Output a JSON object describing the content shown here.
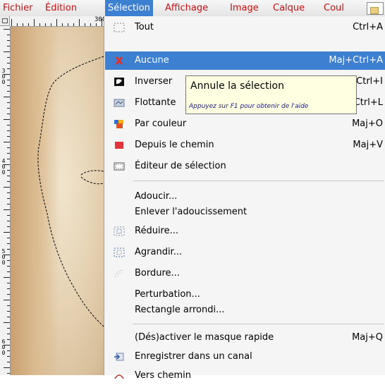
{
  "menubar": {
    "items": [
      "Fichier",
      "Édition",
      "Sélection",
      "Affichage",
      "Image",
      "Calque",
      "Coul"
    ],
    "active_index": 2
  },
  "ruler": {
    "h_label": "300",
    "v_labels": [
      "300",
      "400",
      "500",
      "600"
    ]
  },
  "menu": {
    "items": [
      {
        "label": "Tout",
        "shortcut": "Ctrl+A",
        "icon": "select-all-icon"
      },
      {
        "label": "Aucune",
        "shortcut": "Maj+Ctrl+A",
        "icon": "select-none-icon",
        "highlighted": true
      },
      {
        "label": "Inverser",
        "shortcut": "Ctrl+I",
        "icon": "invert-selection-icon"
      },
      {
        "label": "Flottante",
        "shortcut": "Ctrl+L",
        "icon": "floating-selection-icon"
      },
      {
        "label": "Par couleur",
        "shortcut": "Maj+O",
        "icon": "select-by-color-icon"
      },
      {
        "label": "Depuis le chemin",
        "shortcut": "Maj+V",
        "icon": "path-to-selection-icon"
      },
      {
        "label": "Éditeur de sélection",
        "shortcut": "",
        "icon": "selection-editor-icon"
      },
      {
        "label": "Adoucir...",
        "shortcut": "",
        "icon": ""
      },
      {
        "label": "Enlever l'adoucissement",
        "shortcut": "",
        "icon": ""
      },
      {
        "label": "Réduire...",
        "shortcut": "",
        "icon": "shrink-icon"
      },
      {
        "label": "Agrandir...",
        "shortcut": "",
        "icon": "grow-icon"
      },
      {
        "label": "Bordure...",
        "shortcut": "",
        "icon": "border-icon"
      },
      {
        "label": "Perturbation...",
        "shortcut": "",
        "icon": ""
      },
      {
        "label": "Rectangle arrondi...",
        "shortcut": "",
        "icon": ""
      },
      {
        "label": "(Dés)activer le masque rapide",
        "shortcut": "Maj+Q",
        "icon": ""
      },
      {
        "label": "Enregistrer dans un canal",
        "shortcut": "",
        "icon": "save-to-channel-icon"
      },
      {
        "label": "Vers chemin",
        "shortcut": "",
        "icon": "to-path-icon"
      }
    ]
  },
  "tooltip": {
    "title": "Annule la sélection",
    "help": "Appuyez sur F1 pour obtenir de l'aide"
  },
  "colors": {
    "highlight": "#3d7fd0",
    "menubar_text": "#c21010",
    "tooltip_bg": "#ffffe1"
  }
}
